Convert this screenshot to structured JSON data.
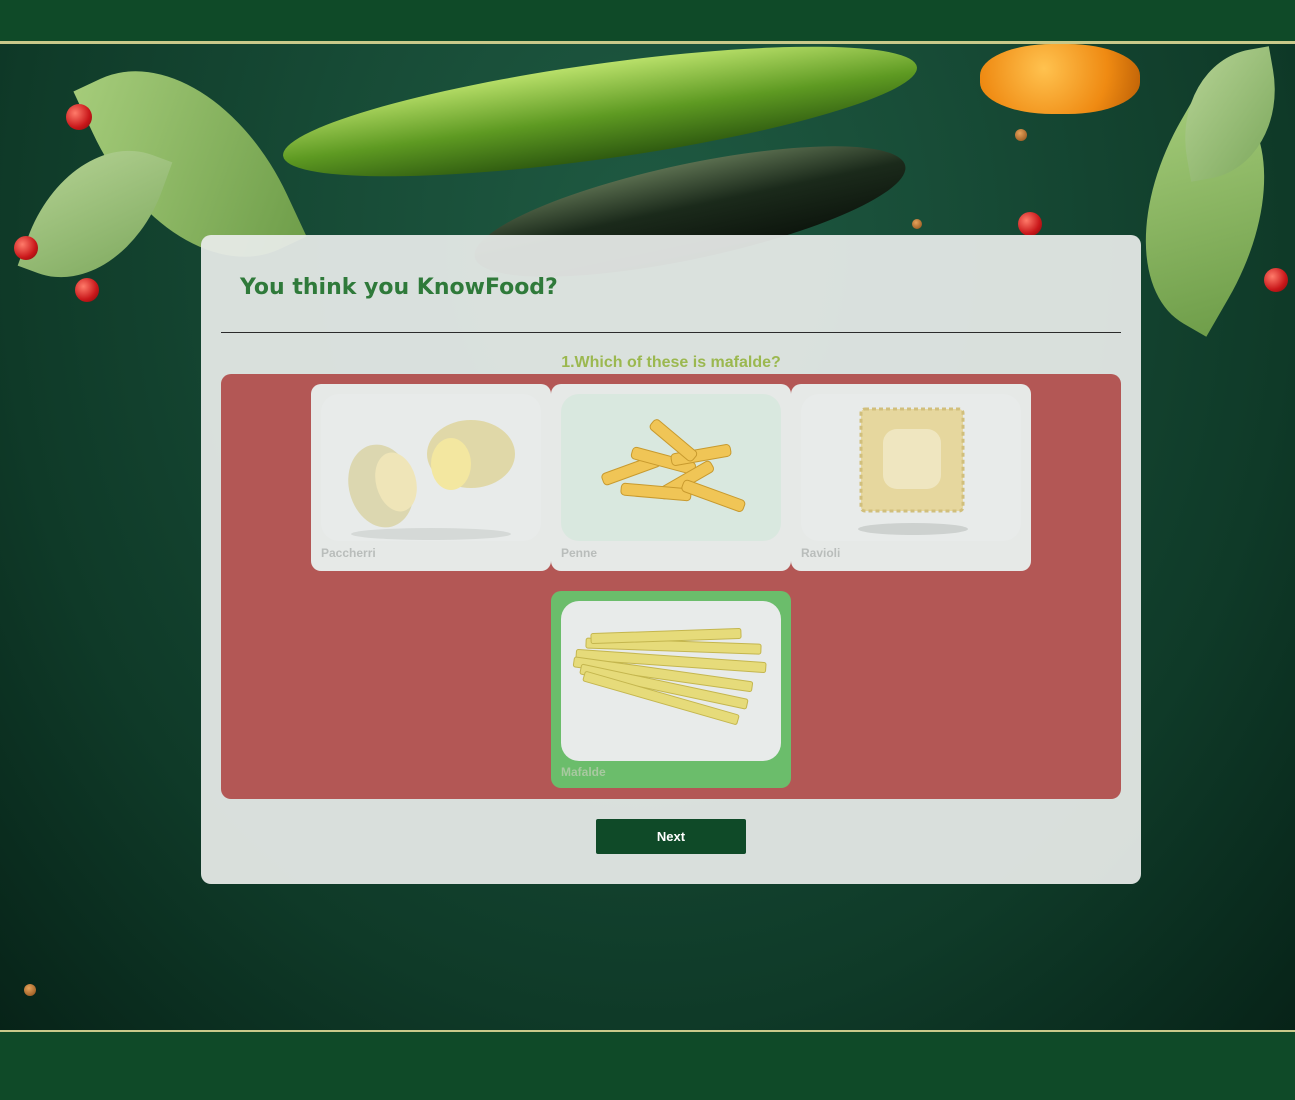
{
  "app": {
    "title": "You think you KnowFood?"
  },
  "quiz": {
    "question": "1.Which of these is mafalde?",
    "options": [
      {
        "label": "Paccherri",
        "image": "paccheri-pasta-photo",
        "state": "incorrect"
      },
      {
        "label": "Penne",
        "image": "penne-pasta-photo",
        "state": "incorrect"
      },
      {
        "label": "Ravioli",
        "image": "ravioli-pasta-photo",
        "state": "incorrect"
      },
      {
        "label": "Mafalde",
        "image": "mafalde-pasta-photo",
        "state": "correct"
      }
    ],
    "next_label": "Next"
  },
  "colors": {
    "header_bg": "#0f4a28",
    "title": "#2f7a3a",
    "question": "#9bb84f",
    "incorrect_area": "#b35755",
    "correct_option": "#6bbd6b",
    "button": "#0f4a28"
  },
  "background": "vegetables-on-dark-green-photo"
}
